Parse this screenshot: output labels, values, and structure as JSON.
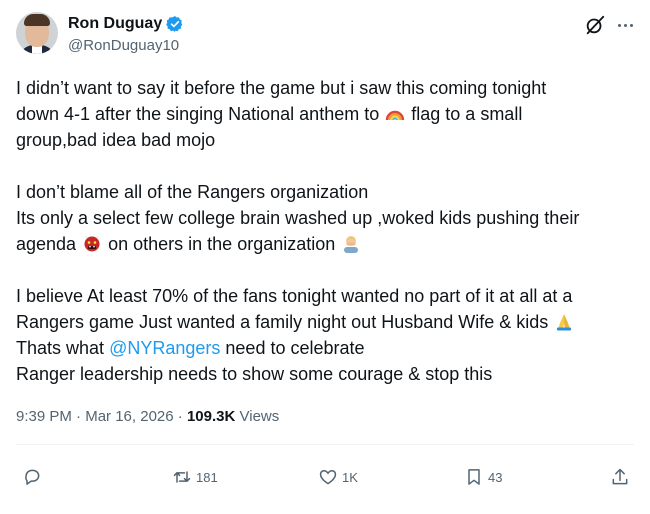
{
  "author": {
    "display_name": "Ron Duguay",
    "handle": "@RonDuguay10",
    "verified": true
  },
  "tweet": {
    "lines": [
      "I didn’t want to say it before the game but i saw this coming tonight",
      "down 4-1 after the singing National anthem  to",
      "flag to a small",
      "group,bad idea bad mojo",
      "I don’t blame all of the Rangers organization",
      "Its only a select few college brain washed up ,woked kids pushing their",
      "agenda",
      "on others in the organization",
      "I believe At least 70% of the fans tonight wanted no part of it at all at a",
      "Rangers game Just wanted a family night out Husband Wife & kids",
      "Thats what",
      "@NYRangers",
      "need to celebrate",
      "Ranger leadership needs to show some courage & stop this"
    ],
    "emojis": [
      "rainbow-emoji",
      "ogre-emoji",
      "man-facepalming-emoji",
      "folded-hands-emoji"
    ]
  },
  "meta": {
    "time": "9:39 PM",
    "separator": "·",
    "date": "Mar 16, 2026",
    "views_count": "109.3K",
    "views_label": "Views"
  },
  "actions": {
    "reply_count": "",
    "retweet_count": "181",
    "like_count": "1K",
    "bookmark_count": "43"
  },
  "colors": {
    "text": "#0f1419",
    "secondary": "#536471",
    "link": "#1d9bf0",
    "verified": "#1d9bf0"
  },
  "icons": [
    "grok-icon",
    "more-icon",
    "reply-icon",
    "retweet-icon",
    "like-icon",
    "bookmark-icon",
    "share-icon",
    "verified-badge-icon"
  ]
}
